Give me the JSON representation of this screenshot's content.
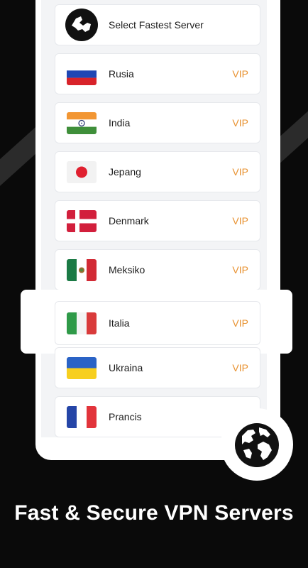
{
  "servers": {
    "fastest_label": "Select Fastest Server",
    "items": [
      {
        "name": "Rusia",
        "badge": "VIP",
        "flag_icon": "russia-flag-icon"
      },
      {
        "name": "India",
        "badge": "VIP",
        "flag_icon": "india-flag-icon"
      },
      {
        "name": "Jepang",
        "badge": "VIP",
        "flag_icon": "japan-flag-icon"
      },
      {
        "name": "Denmark",
        "badge": "VIP",
        "flag_icon": "denmark-flag-icon"
      },
      {
        "name": "Meksiko",
        "badge": "VIP",
        "flag_icon": "mexico-flag-icon"
      },
      {
        "name": "Italia",
        "badge": "VIP",
        "flag_icon": "italy-flag-icon"
      },
      {
        "name": "Ukraina",
        "badge": "VIP",
        "flag_icon": "ukraine-flag-icon"
      },
      {
        "name": "Prancis",
        "badge": "",
        "flag_icon": "france-flag-icon"
      }
    ]
  },
  "tagline": "Fast & Secure VPN Servers",
  "colors": {
    "background": "#0a0a0a",
    "vip": "#e8912f",
    "card": "#ffffff"
  }
}
